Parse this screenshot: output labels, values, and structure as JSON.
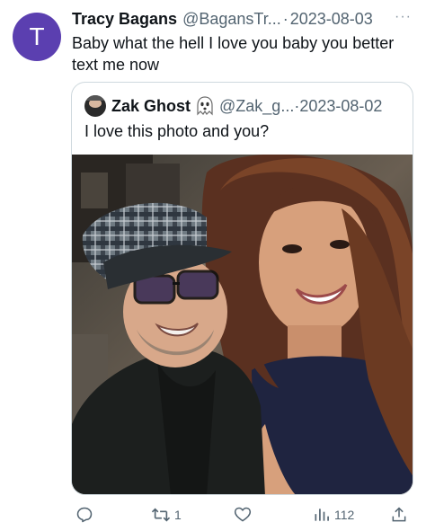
{
  "tweet": {
    "avatar_letter": "T",
    "author_name": "Tracy Bagans",
    "author_handle": "@BagansTr...",
    "separator": "·",
    "date": "2023-08-03",
    "more_label": "···",
    "text": "Baby what the hell I love you baby you better text me now"
  },
  "quote": {
    "author_name": "Zak Ghost",
    "author_handle": "@Zak_g...",
    "separator": "·",
    "date": "2023-08-02",
    "text": "I love this photo and you?",
    "emoji_icon": "ghost-icon"
  },
  "actions": {
    "reply_icon": "reply-icon",
    "retweet_icon": "retweet-icon",
    "retweet_count": "1",
    "like_icon": "heart-icon",
    "views_icon": "views-icon",
    "views_count": "112",
    "share_icon": "share-icon"
  },
  "colors": {
    "avatar_bg": "#5b3fb0",
    "secondary_text": "#536471",
    "border": "#cfd9de"
  }
}
